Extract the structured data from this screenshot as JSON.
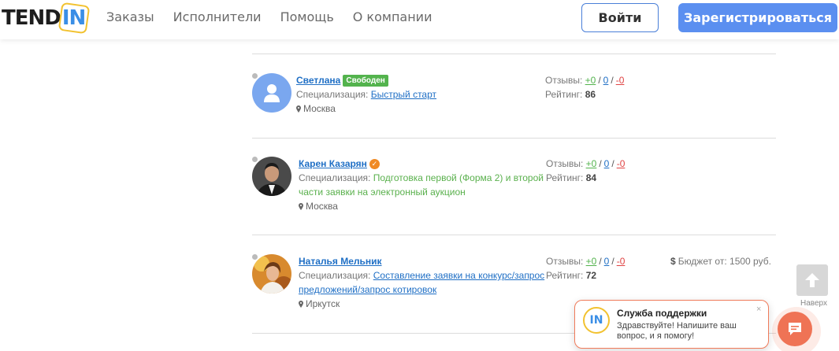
{
  "header": {
    "logo_left": "TEND",
    "logo_right": "IN",
    "nav": [
      "Заказы",
      "Исполнители",
      "Помощь",
      "О компании"
    ],
    "login_label": "Войти",
    "register_label": "Зарегистрироваться"
  },
  "labels": {
    "spec": "Специализация:",
    "reviews": "Отзывы:",
    "rating": "Рейтинг:",
    "budget": "Бюджет от:"
  },
  "executors": [
    {
      "name": "Светлана",
      "badge": "Свободен",
      "spec_line1": "Быстрый старт",
      "spec_line2": "",
      "city": "Москва",
      "reviews_plus": "+0",
      "reviews_zero": "0",
      "reviews_minus": "-0",
      "rating": "86"
    },
    {
      "name": "Карен Казарян",
      "spec_line1": "Подготовка первой (Форма 2) и второй",
      "spec_line2": "части заявки на электронный аукцион",
      "city": "Москва",
      "reviews_plus": "+0",
      "reviews_zero": "0",
      "reviews_minus": "-0",
      "rating": "84"
    },
    {
      "name": "Наталья Мельник",
      "spec_line1": "Составление заявки на конкурс/запрос",
      "spec_line2": "предложений/запрос котировок",
      "city": "Иркутск",
      "reviews_plus": "+0",
      "reviews_zero": "0",
      "reviews_minus": "-0",
      "rating": "72",
      "budget": "1500 руб."
    }
  ],
  "scroll_top_label": "Наверх",
  "support": {
    "logo": "IN",
    "title": "Служба поддержки",
    "message": "Здравствуйте! Напишите ваш вопрос, и я помогу!",
    "close": "×"
  },
  "colors": {
    "accent": "#5b8ff0",
    "link": "#1f6fc5",
    "free_badge": "#53b34d",
    "support_accent": "#ef7355"
  }
}
